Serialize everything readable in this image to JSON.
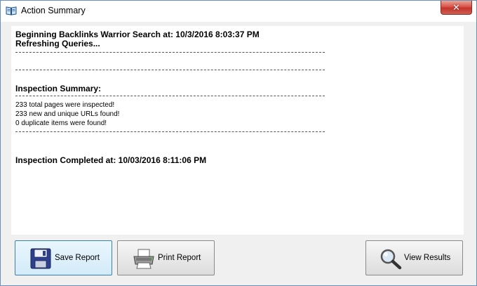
{
  "window": {
    "title": "Action Summary",
    "close_label": "✕"
  },
  "report": {
    "start_line": "Beginning Backlinks Warrior Search at: 10/3/2016 8:03:37 PM",
    "refresh_line": "Refreshing Queries...",
    "summary_heading": "Inspection Summary:",
    "stats": [
      "233 total pages were inspected!",
      "233 new and unique URLs found!",
      "0 duplicate items were found!"
    ],
    "completed_line": "Inspection Completed at: 10/03/2016 8:11:06 PM"
  },
  "buttons": {
    "save": "Save Report",
    "print": "Print Report",
    "view": "View Results"
  },
  "icons": {
    "app": "book-icon",
    "save": "floppy-disk-icon",
    "print": "printer-icon",
    "view": "magnifier-icon"
  },
  "colors": {
    "close_button": "#d9534a",
    "focus_border": "#3c7fb1"
  }
}
